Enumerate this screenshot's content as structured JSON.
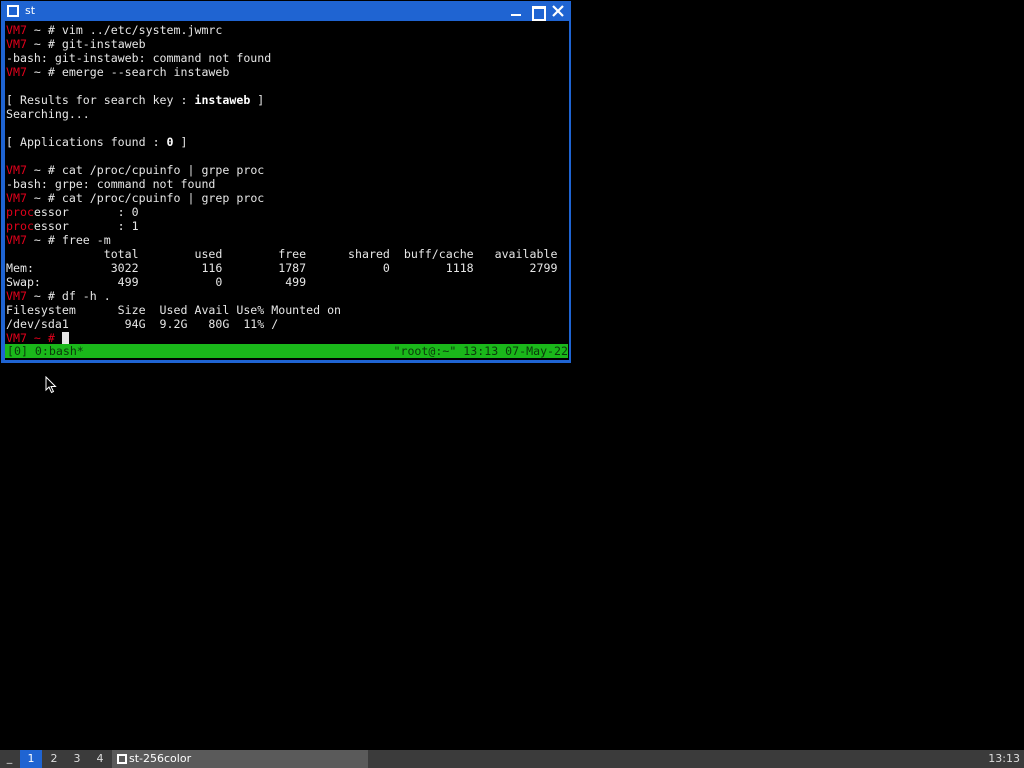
{
  "window": {
    "title": "st"
  },
  "terminal": {
    "lines": [
      [
        {
          "t": "VM7",
          "c": "red"
        },
        {
          "t": " ~ # vim ../etc/system.jwmrc"
        }
      ],
      [
        {
          "t": "VM7",
          "c": "red"
        },
        {
          "t": " ~ # git-instaweb"
        }
      ],
      [
        {
          "t": "-bash: git-instaweb: command not found"
        }
      ],
      [
        {
          "t": "VM7",
          "c": "red"
        },
        {
          "t": " ~ # emerge --search instaweb"
        }
      ],
      [
        {
          "t": ""
        }
      ],
      [
        {
          "t": "[ Results for search key : "
        },
        {
          "t": "instaweb",
          "c": "b"
        },
        {
          "t": " ]"
        }
      ],
      [
        {
          "t": "Searching..."
        }
      ],
      [
        {
          "t": ""
        }
      ],
      [
        {
          "t": "[ Applications found : "
        },
        {
          "t": "0",
          "c": "b"
        },
        {
          "t": " ]"
        }
      ],
      [
        {
          "t": ""
        }
      ],
      [
        {
          "t": "VM7",
          "c": "red"
        },
        {
          "t": " ~ # cat /proc/cpuinfo | grpe proc"
        }
      ],
      [
        {
          "t": "-bash: grpe: command not found"
        }
      ],
      [
        {
          "t": "VM7",
          "c": "red"
        },
        {
          "t": " ~ # cat /proc/cpuinfo | grep proc"
        }
      ],
      [
        {
          "t": "proc",
          "c": "red"
        },
        {
          "t": "essor       : 0"
        }
      ],
      [
        {
          "t": "proc",
          "c": "red"
        },
        {
          "t": "essor       : 1"
        }
      ],
      [
        {
          "t": "VM7",
          "c": "red"
        },
        {
          "t": " ~ # free -m"
        }
      ],
      [
        {
          "t": "              total        used        free      shared  buff/cache   available"
        }
      ],
      [
        {
          "t": "Mem:           3022         116        1787           0        1118        2799"
        }
      ],
      [
        {
          "t": "Swap:           499           0         499"
        }
      ],
      [
        {
          "t": "VM7",
          "c": "red"
        },
        {
          "t": " ~ # df -h ."
        }
      ],
      [
        {
          "t": "Filesystem      Size  Used Avail Use% Mounted on"
        }
      ],
      [
        {
          "t": "/dev/sda1        94G  9.2G   80G  11% /"
        }
      ]
    ],
    "prompt": "VM7 ~ # "
  },
  "tmux": {
    "left": "[0] 0:bash*",
    "right": "\"root@:~\" 13:13 07-May-22"
  },
  "taskbar": {
    "menu": "_",
    "desktops": [
      "1",
      "2",
      "3",
      "4"
    ],
    "active_desktop": "1",
    "task_label": "st-256color",
    "clock": "13:13"
  },
  "icons": {
    "window": "window-icon",
    "minimize": "minimize-icon",
    "maximize": "maximize-icon",
    "close": "close-icon",
    "mouse": "mouse-pointer-icon"
  }
}
